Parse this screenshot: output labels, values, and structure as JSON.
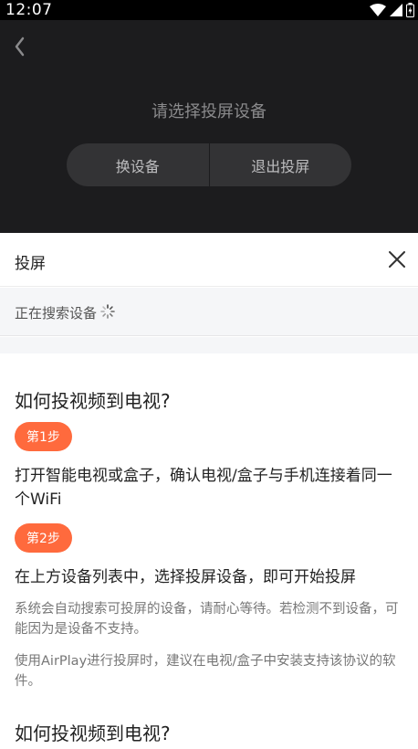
{
  "status_bar": {
    "time": "12:07"
  },
  "player": {
    "title": "请选择投屏设备",
    "switch_device_label": "换设备",
    "exit_cast_label": "退出投屏"
  },
  "sheet": {
    "title": "投屏",
    "searching_text": "正在搜索设备"
  },
  "help": {
    "heading": "如何投视频到电视?",
    "step1_badge": "第1步",
    "step1_text": "打开智能电视或盒子，确认电视/盒子与手机连接着同一个WiFi",
    "step2_badge": "第2步",
    "step2_text": "在上方设备列表中，选择投屏设备，即可开始投屏",
    "note1": "系统会自动搜索可投屏的设备，请耐心等待。若检测不到设备，可能因为是设备不支持。",
    "note2": "使用AirPlay进行投屏时，建议在电视/盒子中安装支持该协议的软件。",
    "heading2": "如何投视频到电视?"
  },
  "colors": {
    "accent": "#ff6a3d",
    "player_bg": "#1c1c1e"
  }
}
